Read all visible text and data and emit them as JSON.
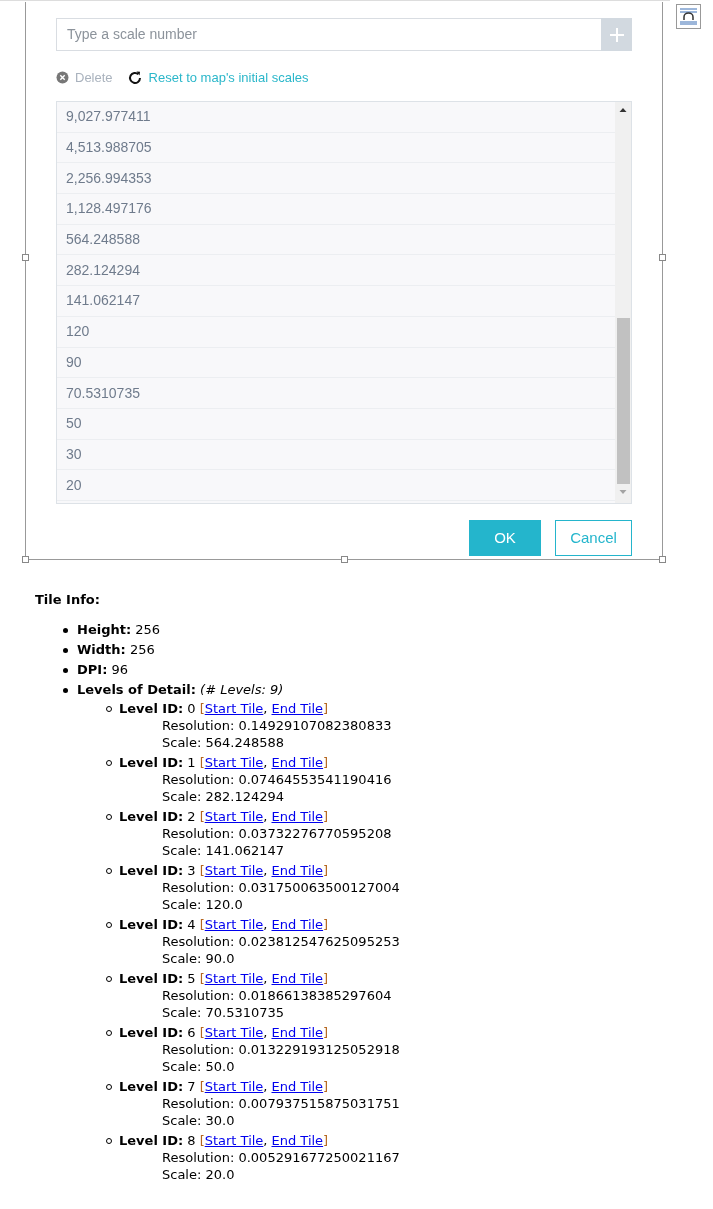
{
  "scale_dialog": {
    "input": {
      "placeholder": "Type a scale number"
    },
    "delete": {
      "label": "Delete",
      "disabled": true
    },
    "reset": {
      "label": "Reset to map's initial scales"
    },
    "scales": [
      "9,027.977411",
      "4,513.988705",
      "2,256.994353",
      "1,128.497176",
      "564.248588",
      "282.124294",
      "141.062147",
      "120",
      "90",
      "70.5310735",
      "50",
      "30",
      "20"
    ],
    "ok": "OK",
    "cancel": "Cancel"
  },
  "tile_info": {
    "title": "Tile Info:",
    "items": [
      {
        "label": "Height:",
        "value": "256"
      },
      {
        "label": "Width:",
        "value": "256"
      },
      {
        "label": "DPI:",
        "value": "96"
      }
    ],
    "levels_of_detail": {
      "label": "Levels of Detail:",
      "note": "(# Levels: 9)",
      "levels": [
        {
          "label": "Level ID:",
          "id": "0",
          "open": "[",
          "start": "Start Tile",
          "sep": ",",
          "end": "End Tile",
          "close": "]",
          "resolution": "Resolution: 0.14929107082380833",
          "scale": "Scale: 564.248588"
        },
        {
          "label": "Level ID:",
          "id": "1",
          "open": "[",
          "start": "Start Tile",
          "sep": ",",
          "end": "End Tile",
          "close": "]",
          "resolution": "Resolution: 0.07464553541190416",
          "scale": "Scale: 282.124294"
        },
        {
          "label": "Level ID:",
          "id": "2",
          "open": "[",
          "start": "Start Tile",
          "sep": ",",
          "end": "End Tile",
          "close": "]",
          "resolution": "Resolution: 0.03732276770595208",
          "scale": "Scale: 141.062147"
        },
        {
          "label": "Level ID:",
          "id": "3",
          "open": "[",
          "start": "Start Tile",
          "sep": ",",
          "end": "End Tile",
          "close": "]",
          "resolution": "Resolution: 0.031750063500127004",
          "scale": "Scale: 120.0"
        },
        {
          "label": "Level ID:",
          "id": "4",
          "open": "[",
          "start": "Start Tile",
          "sep": ",",
          "end": "End Tile",
          "close": "]",
          "resolution": "Resolution: 0.023812547625095253",
          "scale": "Scale: 90.0"
        },
        {
          "label": "Level ID:",
          "id": "5",
          "open": "[",
          "start": "Start Tile",
          "sep": ",",
          "end": "End Tile",
          "close": "]",
          "resolution": "Resolution: 0.01866138385297604",
          "scale": "Scale: 70.5310735"
        },
        {
          "label": "Level ID:",
          "id": "6",
          "open": "[",
          "start": "Start Tile",
          "sep": ",",
          "end": "End Tile",
          "close": "]",
          "resolution": "Resolution: 0.013229193125052918",
          "scale": "Scale: 50.0"
        },
        {
          "label": "Level ID:",
          "id": "7",
          "open": "[",
          "start": "Start Tile",
          "sep": ",",
          "end": "End Tile",
          "close": "]",
          "resolution": "Resolution: 0.007937515875031751",
          "scale": "Scale: 30.0"
        },
        {
          "label": "Level ID:",
          "id": "8",
          "open": "[",
          "start": "Start Tile",
          "sep": ",",
          "end": "End Tile",
          "close": "]",
          "resolution": "Resolution: 0.005291677250021167",
          "scale": "Scale: 20.0"
        }
      ]
    }
  }
}
